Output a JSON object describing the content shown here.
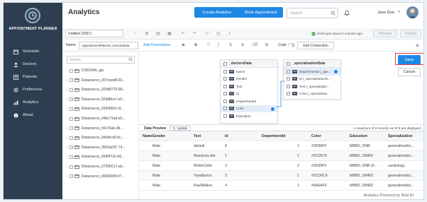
{
  "sidebar": {
    "brand": "APPOINTMENT PLANNER",
    "items": [
      {
        "label": "Schedule",
        "icon": "calendar-icon"
      },
      {
        "label": "Doctors",
        "icon": "doctor-icon"
      },
      {
        "label": "Patients",
        "icon": "patients-icon"
      },
      {
        "label": "Preference",
        "icon": "settings-icon"
      },
      {
        "label": "Analytics",
        "icon": "analytics-icon"
      },
      {
        "label": "About",
        "icon": "info-icon"
      }
    ]
  },
  "header": {
    "title": "Analytics",
    "create_btn": "Create Analytics",
    "book_btn": "Book Appointment",
    "search_placeholder": "Search",
    "user": "Jane Doe"
  },
  "toolbar": {
    "filename": "Untitled (2567)",
    "draft": "Draft auto saved 2 minutes ago",
    "preview": "Preview",
    "publish": "Publish"
  },
  "subbar": {
    "name_label": "Name",
    "name_value": "AppointmentPlanner_DoctorData",
    "add_description": "Add Description",
    "code_label": "Code",
    "edit_connection": "Edit Connection"
  },
  "actions": {
    "save": "Save",
    "cancel": "Cancel"
  },
  "tree": {
    "search_placeholder": "Search",
    "items": [
      "CORONA_api",
      "Datasource_007ceed8-03...",
      "Datasource_024d8775-86...",
      "Datasource_02dd8ca7-e5...",
      "Datasource_035468cf-c9...",
      "Datasource_04bc71ad-e6...",
      "Datasource_04c15ab-db...",
      "Datasource_04ebfcd0-6c...",
      "Datasource_0563a037-74...",
      "Datasource_095f472e-b6...",
      "Datasource_07395517-ab...",
      "Datasource_09534d0f-47..."
    ]
  },
  "tables": [
    {
      "title": "_doctorsData",
      "columns": [
        {
          "name": "Name",
          "type": "abc",
          "checked": true
        },
        {
          "name": "Gender",
          "type": "abc",
          "checked": true
        },
        {
          "name": "Text",
          "type": "abc",
          "checked": true
        },
        {
          "name": "Id",
          "type": "123",
          "checked": true
        },
        {
          "name": "DepartmentId",
          "type": "123",
          "checked": true
        },
        {
          "name": "Color",
          "type": "abc",
          "checked": true,
          "selected": true
        },
        {
          "name": "Education",
          "type": "abc",
          "checked": true
        }
      ]
    },
    {
      "title": "_specializationData",
      "columns": [
        {
          "name": "DepartmentId (_spe...",
          "type": "123",
          "checked": true,
          "selected": true
        },
        {
          "name": "Id (_specializationD...",
          "type": "abc",
          "checked": true
        },
        {
          "name": "Text (_specializatio...",
          "type": "abc",
          "checked": true
        },
        {
          "name": "Color (_specializati...",
          "type": "abc",
          "checked": true
        }
      ]
    }
  ],
  "data_preview": {
    "label": "Data Preview",
    "update_btn": "Update",
    "info": "A maximum of 8 records out of 8 are displayed",
    "headers": [
      "Name",
      "Gender",
      "Text",
      "Id",
      "DepartmentId",
      "Color",
      "Education",
      "Specialization"
    ],
    "rows": [
      [
        "",
        "Male",
        "default",
        "8",
        "1",
        "#2D99FF",
        "MBBS, DNB",
        "generalmedici..."
      ],
      [
        "",
        "Male",
        "NembocLuktr",
        "1",
        "1",
        "#2CD576",
        "MBBS, DMRD",
        "generalmedici..."
      ],
      [
        "",
        "Male",
        "MollinCobb",
        "2",
        "2",
        "#2D99FF",
        "MBBS, DNB (F...",
        "cardiology"
      ],
      [
        "",
        "Male",
        "YaraBarros",
        "3",
        "1",
        "#2CD0C6",
        "MBBS, DMRD",
        "generalmedici..."
      ],
      [
        "",
        "Male",
        "PaulWalker",
        "4",
        "1",
        "#6A6AF5",
        "MBBS, DMRD",
        "generalmedici..."
      ]
    ]
  },
  "footer": "Analytics Powered by Bold BI",
  "colors": {
    "sidebar": "#2c3e50",
    "accent": "#1e88e5",
    "highlight": "#e53935"
  }
}
